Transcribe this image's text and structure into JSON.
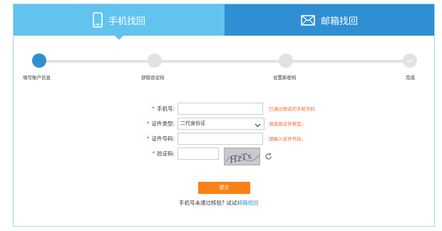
{
  "tabs": {
    "phone": {
      "label": "手机找回",
      "icon": "mobile-phone-icon"
    },
    "email": {
      "label": "邮箱找回",
      "icon": "envelope-icon"
    }
  },
  "steps": [
    {
      "label": "填写账户信息",
      "state": "active"
    },
    {
      "label": "获取验证码",
      "state": "pending"
    },
    {
      "label": "设置新密码",
      "state": "pending"
    },
    {
      "label": "完成",
      "state": "pending",
      "icon": "check-icon"
    }
  ],
  "form": {
    "phone": {
      "label": "手机号:",
      "value": "",
      "hint": "已通过核验的手机号码"
    },
    "id_type": {
      "label": "证件类型:",
      "selected": "二代身份证",
      "hint": "请选择证件类型。"
    },
    "id_number": {
      "label": "证件号码:",
      "value": "",
      "hint": "请输入证件号码。"
    },
    "captcha": {
      "label": "验证码:",
      "value": "",
      "image_text": "HzTx",
      "refresh_icon": "refresh-icon"
    }
  },
  "submit_label": "提交",
  "alt_prompt": {
    "text": "手机号未通过核验? 试试",
    "link": "邮箱找回"
  },
  "colors": {
    "tab_active": "#62c3ee",
    "tab_inactive": "#2f8fd3",
    "accent": "#2f8fd3",
    "submit": "#f88216",
    "hint": "#ee6a2b",
    "required": "#e0492f"
  }
}
